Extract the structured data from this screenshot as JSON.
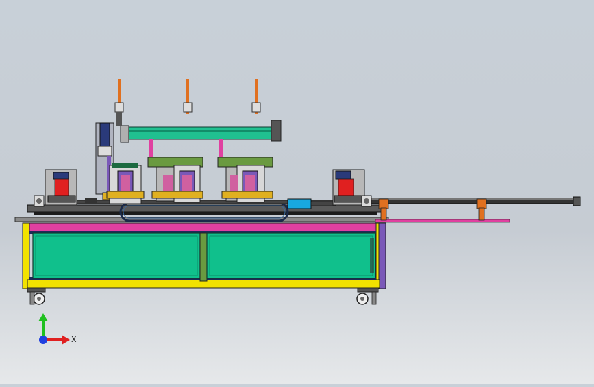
{
  "triad": {
    "x_label": "X",
    "y_label": "",
    "colors": {
      "x": "#e02020",
      "y": "#20c020",
      "z": "#2040e0"
    }
  },
  "colors": {
    "frame_yellow": "#f2e200",
    "frame_magenta": "#e040a0",
    "panel_green": "#10c08c",
    "frame_purple": "#7a58b8",
    "background": "#c8d0d8"
  },
  "icons": [
    "axis-triad-icon",
    "caster-wheel-icon"
  ]
}
